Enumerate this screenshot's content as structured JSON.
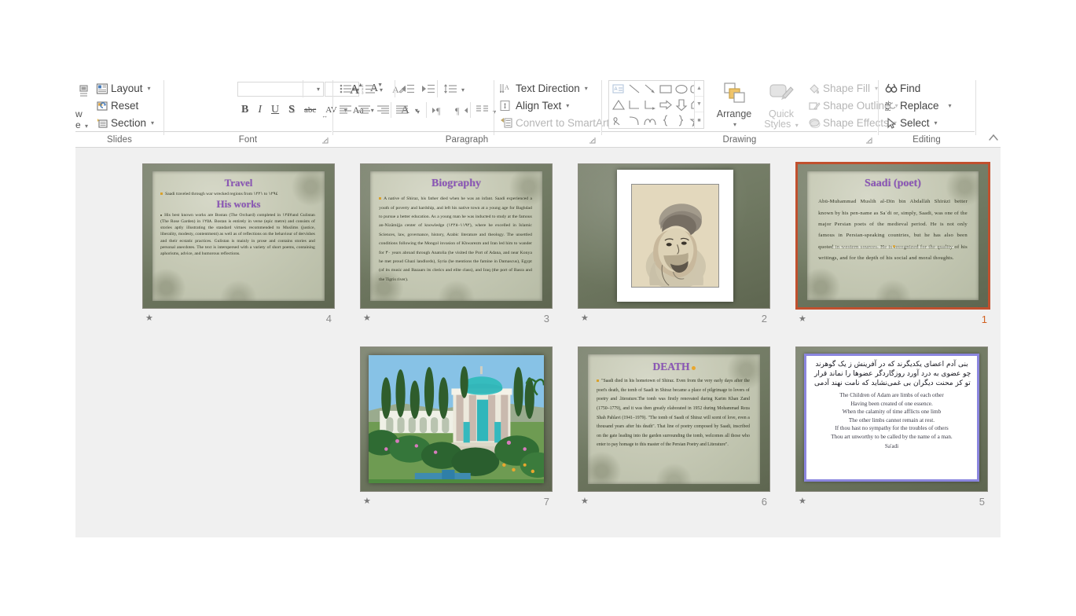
{
  "app": {
    "name": "PowerPoint Slide Sorter"
  },
  "ribbon": {
    "groups": {
      "slides": {
        "label": "Slides",
        "items": [
          {
            "name": "layout",
            "label": "Layout",
            "icon": "layout-icon",
            "caret": "▾"
          },
          {
            "name": "reset",
            "label": "Reset",
            "icon": "reset-icon",
            "caret": ""
          },
          {
            "name": "section",
            "label": "Section",
            "icon": "section-icon",
            "caret": "▾"
          }
        ]
      },
      "font": {
        "label": "Font",
        "font_name_value": "",
        "font_name_placeholder": "",
        "font_size_value": "",
        "font_size_placeholder": "",
        "grow_font": "A",
        "shrink_font": "A",
        "clear_formatting": "clear-formatting-icon",
        "bold": "B",
        "italic": "I",
        "underline": "U",
        "shadow": "S",
        "strikethrough": "abc",
        "char_spacing": "AV",
        "change_case": "Aa",
        "font_color": "A",
        "launcher": "⤵"
      },
      "paragraph": {
        "label": "Paragraph",
        "text_direction": "Text Direction",
        "align_text": "Align Text",
        "convert_to_smartart": "Convert to SmartArt",
        "launcher": "⤵"
      },
      "drawing": {
        "label": "Drawing",
        "arrange": "Arrange",
        "quick_styles_line1": "Quick",
        "quick_styles_line2": "Styles",
        "shape_fill": "Shape Fill",
        "shape_outline": "Shape Outline",
        "shape_effects": "Shape Effects",
        "launcher": "⤵"
      },
      "editing": {
        "label": "Editing",
        "find": "Find",
        "replace": "Replace",
        "select": "Select"
      }
    },
    "collapse_ribbon": "⌃"
  },
  "slides": [
    {
      "number": "4",
      "kind": "text",
      "animation_star": "★",
      "selected": false,
      "titles": [
        "Travel",
        "His works"
      ],
      "paragraphs": [
        "Saadi traveled through war wrecked regions from  ١٢٢١ to ١٢٩٤",
        "His best known works are Bostan (The Orchard) completed in  ١٢٥٧and Gulistan (The Rose Garden) in ١٢٥٨. Bostan is entirely in verse (epic metre) and consists of stories aptly illustrating the standard virtues recommended to Muslims (justice, liberality, modesty, contentment) as well as of reflections on the behaviour of dervishes and their ecstatic practices. Gulistan is mainly in prose and contains stories and personal anecdotes. The text is interspersed with a variety of short poems, containing aphorisms, advice, and humorous reflections."
      ]
    },
    {
      "number": "3",
      "kind": "text",
      "animation_star": "★",
      "selected": false,
      "titles": [
        "Biography"
      ],
      "paragraphs": [
        "A native of Shiraz, his father died when he was an infant. Saadi experienced a youth of poverty and hardship, and left his native town at a young age for Baghdad to pursue a better education. As a young man he was inducted to study at the famous an-Nizāmijja center of knowledge (١١٩٢–١٢٢٨), where he excelled in Islamic Sciences, law, governance, history, Arabic literature and theology. The unsettled conditions following the Mongol invasion of Khwarezm and Iran led him to wander for  ٣٠ years abroad through Anatolia (he visited the Port of Adana, and near Konya he met proud Ghazi landlords), Syria (he mentions the famine in Damascus), Egypt (of its music and Bazaars its clerics and elite class), and Iraq (the port of Basra and the Tigris river)."
      ]
    },
    {
      "number": "2",
      "kind": "portrait",
      "animation_star": "★",
      "selected": false,
      "alt": "Drawn portrait of Saadi wearing a turban"
    },
    {
      "number": "1",
      "kind": "text",
      "animation_star": "★",
      "selected": true,
      "titles": [
        "Saadi (poet)"
      ],
      "paragraphs": [
        "Abū-Muhammad Muslih al-Dīn bin Abdallāh Shīrāzī better known by his pen-name as Saʿdi  or, simply, Saadi, was one of the major Persian poets of the medieval period. He is not only famous in Persian-speaking countries, but he has also been quoted in western sources. He is recognized for the quality of his writings, and for the depth of his social and moral thoughts."
      ]
    },
    {
      "number": "7",
      "kind": "tomb",
      "animation_star": "★",
      "selected": false,
      "alt": "Photograph of the Tomb of Saadi garden in Shiraz"
    },
    {
      "number": "6",
      "kind": "text",
      "animation_star": "★",
      "selected": false,
      "titles": [
        "DEATH"
      ],
      "paragraphs": [
        "\"Saadi died in his hometown of Shiraz. Even from the very early days after the poet's death, the tomb of Saadi in Shiraz became a place of pilgrimage to lovers of poetry and .literature.The tomb was firstly renovated during Karim Khan Zand (1750–1779), and it was then greatly elaborated in 1952 during Mohammad Reza Shah Pahlavi (1941–1979). \"The tomb of Saadi of Shiraz will scent of love, even a thousand years after his death\". That line of poetry composed by Saadi, inscribed on the gate leading into the garden surrounding the tomb, welcomes all those who enter to pay homage to this master of the Persian Poetry and Literature\"."
      ]
    },
    {
      "number": "5",
      "kind": "calligraphy",
      "animation_star": "★",
      "selected": false,
      "calligraphy_lines": [
        "بنی آدم اعضای یکدیگرند",
        "که در آفرینش ز یک گوهرند",
        "چو عضوی به درد آورد روزگار",
        "دگر عضوها را نماند قرار",
        "تو کز محنت دیگران بی غمی",
        "نشاید که نامت نهند آدمی"
      ],
      "translation_lines": [
        "The Children of Adam are limbs of each other",
        "Having been created of one essence.",
        "When the calamity of time afflicts one limb",
        "The other limbs cannot remain at rest.",
        "If thou hast no sympathy for the troubles of others",
        "Thou art unworthy to be called by the name of a man."
      ],
      "attribution": "Sa'adi"
    }
  ],
  "colors": {
    "selection": "#c1502e",
    "selected_number": "#d2601f",
    "title_purple": "#8b55b8",
    "pane_background": "#f0f0f0",
    "slide_background": "#6e7561"
  }
}
